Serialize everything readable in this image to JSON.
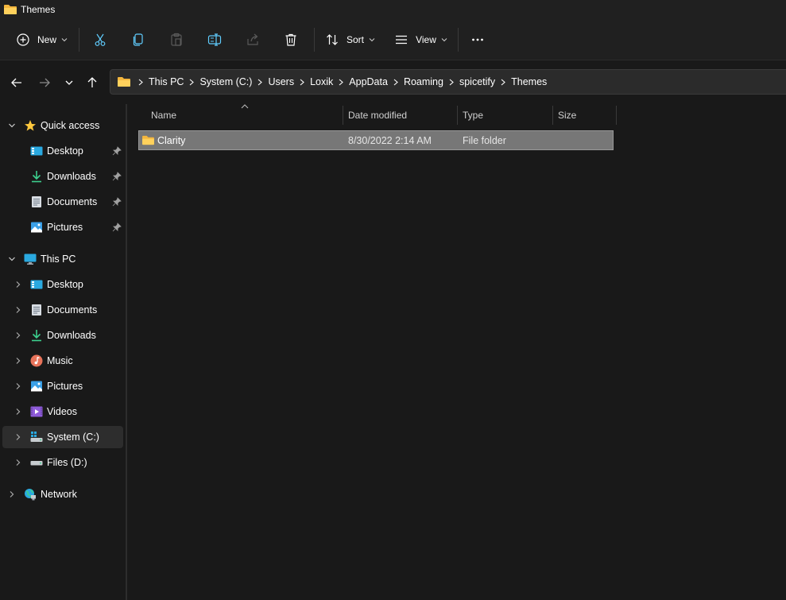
{
  "window": {
    "title": "Themes"
  },
  "toolbar": {
    "new_label": "New",
    "sort_label": "Sort",
    "view_label": "View",
    "icons": [
      "plus-circle-icon",
      "cut-icon",
      "copy-icon",
      "paste-icon",
      "rename-icon",
      "share-icon",
      "delete-icon",
      "sort-icon",
      "view-icon",
      "more-icon"
    ]
  },
  "address": {
    "crumbs": [
      "This PC",
      "System (C:)",
      "Users",
      "Loxik",
      "AppData",
      "Roaming",
      "spicetify",
      "Themes"
    ]
  },
  "sidebar": {
    "quick_access": {
      "label": "Quick access",
      "items": [
        {
          "label": "Desktop",
          "icon": "desktop-icon",
          "pinned": true
        },
        {
          "label": "Downloads",
          "icon": "downloads-icon",
          "pinned": true
        },
        {
          "label": "Documents",
          "icon": "documents-icon",
          "pinned": true
        },
        {
          "label": "Pictures",
          "icon": "pictures-icon",
          "pinned": true
        }
      ]
    },
    "this_pc": {
      "label": "This PC",
      "items": [
        {
          "label": "Desktop",
          "icon": "desktop-icon"
        },
        {
          "label": "Documents",
          "icon": "documents-icon"
        },
        {
          "label": "Downloads",
          "icon": "downloads-icon"
        },
        {
          "label": "Music",
          "icon": "music-icon"
        },
        {
          "label": "Pictures",
          "icon": "pictures-icon"
        },
        {
          "label": "Videos",
          "icon": "videos-icon"
        },
        {
          "label": "System (C:)",
          "icon": "drive-c-icon",
          "selected": true
        },
        {
          "label": "Files (D:)",
          "icon": "drive-d-icon"
        }
      ]
    },
    "network": {
      "label": "Network",
      "icon": "network-icon"
    }
  },
  "list": {
    "columns": [
      "Name",
      "Date modified",
      "Type",
      "Size"
    ],
    "rows": [
      {
        "name": "Clarity",
        "date_modified": "8/30/2022 2:14 AM",
        "type": "File folder",
        "size": ""
      }
    ]
  },
  "colors": {
    "accent": "#60cdff",
    "folder": "#ffc83d",
    "background": "#191919",
    "chrome": "#202020",
    "selection": "#777777"
  }
}
